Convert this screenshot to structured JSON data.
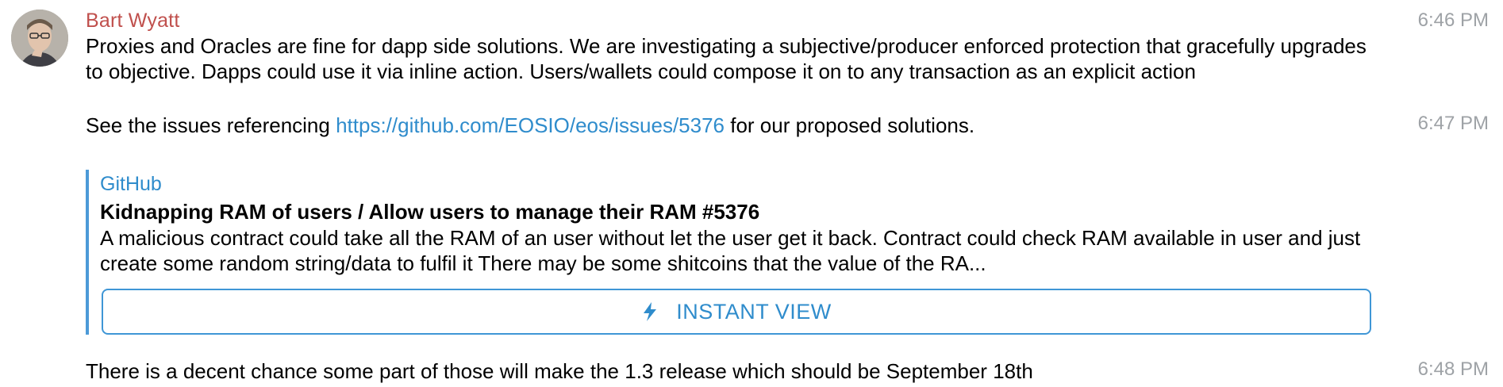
{
  "author": {
    "name": "Bart Wyatt",
    "avatar_icon": "avatar-photo-icon"
  },
  "messages": [
    {
      "time": "6:46 PM",
      "text": "Proxies and Oracles are fine for dapp side solutions.  We are investigating a subjective/producer enforced protection that gracefully upgrades to objective. Dapps could use it via inline action.  Users/wallets could compose it on to any transaction as an explicit action"
    },
    {
      "time": "6:47 PM",
      "text_before": "See the issues referencing ",
      "link": "https://github.com/EOSIO/eos/issues/5376",
      "text_after": " for our proposed solutions."
    },
    {
      "time": "6:48 PM",
      "text": "There is a decent chance some part of those will make the 1.3 release which should be September 18th"
    }
  ],
  "link_preview": {
    "site_name": "GitHub",
    "title": "Kidnapping RAM of users / Allow users to manage their RAM #5376",
    "description": "A malicious contract could take all the RAM of an user without let the user get it back. Contract could check RAM available in user and just create some random string/data to fulfil it There may be some shitcoins that the value of the RA...",
    "button_label": "INSTANT VIEW",
    "button_icon": "lightning-bolt-icon"
  },
  "colors": {
    "author": "#c0504d",
    "link": "#2f8ccc",
    "timestamp": "#9ea2a6",
    "preview_bar": "#4c9ad8"
  }
}
